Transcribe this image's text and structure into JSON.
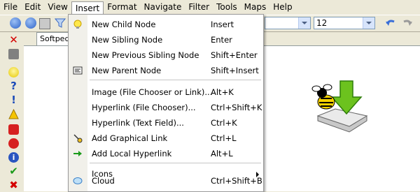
{
  "menubar": {
    "items": [
      "File",
      "Edit",
      "View",
      "Insert",
      "Format",
      "Navigate",
      "Filter",
      "Tools",
      "Maps",
      "Help"
    ]
  },
  "toolbar": {
    "font_size_value": "12"
  },
  "tab": {
    "label": "Softpedi"
  },
  "insert_menu": {
    "items": [
      {
        "label": "New Child Node",
        "shortcut": "Insert",
        "icon": "lightbulb-icon"
      },
      {
        "label": "New Sibling Node",
        "shortcut": "Enter",
        "icon": ""
      },
      {
        "label": "New Previous Sibling Node",
        "shortcut": "Shift+Enter",
        "icon": ""
      },
      {
        "label": "New Parent Node",
        "shortcut": "Shift+Insert",
        "icon": "parent-node-icon"
      },
      {
        "label": "Image (File Chooser or Link)...",
        "shortcut": "Alt+K",
        "icon": ""
      },
      {
        "label": "Hyperlink (File Chooser)...",
        "shortcut": "Ctrl+Shift+K",
        "icon": ""
      },
      {
        "label": "Hyperlink (Text Field)...",
        "shortcut": "Ctrl+K",
        "icon": ""
      },
      {
        "label": "Add Graphical Link",
        "shortcut": "Ctrl+L",
        "icon": "graphical-link-icon"
      },
      {
        "label": "Add Local Hyperlink",
        "shortcut": "Alt+L",
        "icon": "local-link-arrow-icon"
      },
      {
        "label": "Icons",
        "shortcut": "",
        "icon": ""
      },
      {
        "label": "Cloud",
        "shortcut": "Ctrl+Shift+B",
        "icon": "cloud-icon"
      }
    ]
  },
  "colors": {
    "accent_blue": "#3a6fd8",
    "menu_gutter": "#f1f0ea",
    "window_bg": "#ece9d8"
  }
}
